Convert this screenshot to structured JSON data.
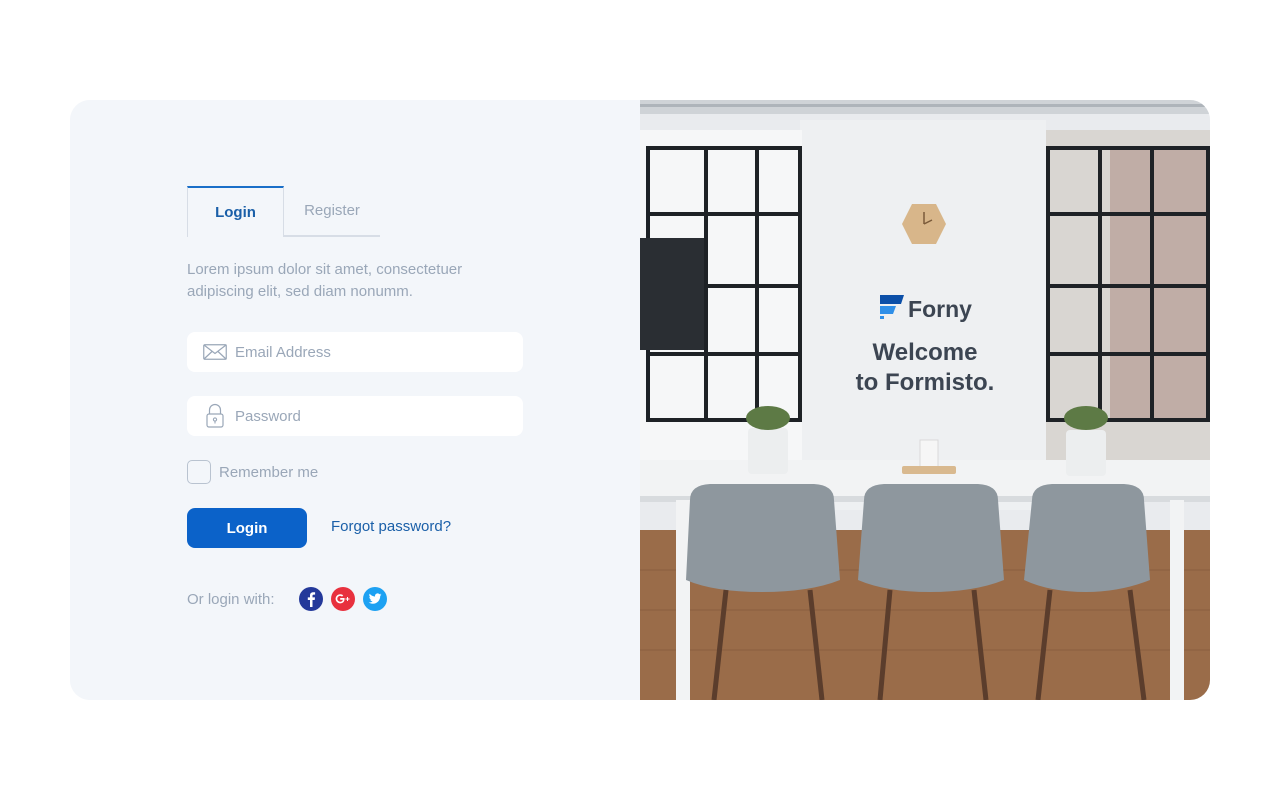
{
  "tabs": {
    "login": "Login",
    "register": "Register"
  },
  "description": "Lorem ipsum dolor sit amet, consectetuer adipiscing elit, sed diam nonumm.",
  "fields": {
    "email_placeholder": "Email Address",
    "password_placeholder": "Password"
  },
  "remember_label": "Remember me",
  "login_button": "Login",
  "forgot_link": "Forgot password?",
  "social": {
    "label": "Or login with:",
    "icons": [
      "facebook-icon",
      "google-plus-icon",
      "twitter-icon"
    ]
  },
  "brand": {
    "name": "Forny"
  },
  "welcome": {
    "line1": "Welcome",
    "line2": "to Formisto."
  },
  "colors": {
    "accent": "#0b62c9",
    "link": "#1a5fa8",
    "panel_bg": "#f3f6fa",
    "muted_text": "#9aa7b8",
    "facebook": "#24399a",
    "google": "#e8313e",
    "twitter": "#1da1f2"
  }
}
